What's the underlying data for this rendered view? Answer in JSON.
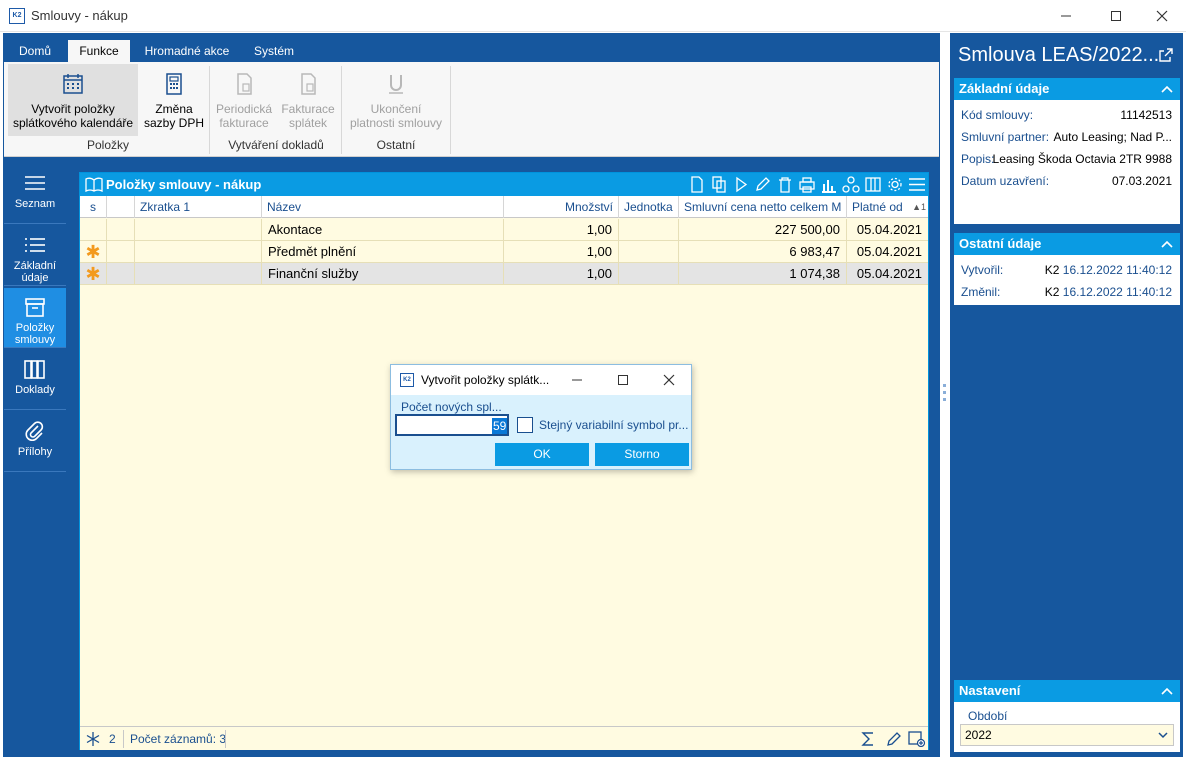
{
  "window": {
    "title": "Smlouvy - nákup",
    "logo": "K2"
  },
  "ribbon": {
    "tabs": [
      {
        "label": "Domů"
      },
      {
        "label": "Funkce"
      },
      {
        "label": "Hromadné akce"
      },
      {
        "label": "Systém"
      }
    ],
    "buttons": {
      "create_items": {
        "line1": "Vytvořit položky",
        "line2": "splátkového kalendáře"
      },
      "vat_change": {
        "line1": "Změna",
        "line2": "sazby DPH"
      },
      "periodic_invoice": {
        "line1": "Periodická",
        "line2": "fakturace"
      },
      "installment_invoice": {
        "line1": "Fakturace",
        "line2": "splátek"
      },
      "end_validity": {
        "line1": "Ukončení",
        "line2": "platnosti smlouvy"
      }
    },
    "groups": {
      "items": "Položky",
      "documents": "Vytváření dokladů",
      "other": "Ostatní"
    }
  },
  "nav": {
    "list": "Seznam",
    "basic_1": "Základní",
    "basic_2": "údaje",
    "items_1": "Položky",
    "items_2": "smlouvy",
    "docs": "Doklady",
    "attachments": "Přílohy"
  },
  "grid": {
    "title": "Položky smlouvy - nákup",
    "columns": {
      "s": "s",
      "abbr": "Zkratka 1",
      "name": "Název",
      "qty": "Množství",
      "unit": "Jednotka",
      "price": "Smluvní cena netto celkem M",
      "valid": "Platné od"
    },
    "sort_marker": "1",
    "rows": [
      {
        "name": "Akontace",
        "qty": "1,00",
        "price": "227 500,00",
        "valid": "05.04.2021"
      },
      {
        "name": "Předmět plnění",
        "qty": "1,00",
        "price": "6 983,47",
        "valid": "05.04.2021"
      },
      {
        "name": "Finanční služby",
        "qty": "1,00",
        "price": "1 074,38",
        "valid": "05.04.2021"
      }
    ],
    "footer": {
      "count_num": "2",
      "records": "Počet záznamů: 3"
    }
  },
  "right": {
    "title": "Smlouva LEAS/2022...",
    "basic": {
      "header": "Základní údaje",
      "contract_code_label": "Kód smlouvy:",
      "contract_code": "11142513",
      "partner_label": "Smluvní partner:",
      "partner": "Auto Leasing; Nad P...",
      "desc_label": "Popis:",
      "desc": "Leasing Škoda Octavia 2TR 9988",
      "date_label": "Datum uzavření:",
      "date": "07.03.2021"
    },
    "other": {
      "header": "Ostatní údaje",
      "created_label": "Vytvořil:",
      "created_user": "K2",
      "created_date": "16.12.2022 11:40:12",
      "changed_label": "Změnil:",
      "changed_user": "K2",
      "changed_date": "16.12.2022 11:40:12"
    },
    "settings": {
      "header": "Nastavení",
      "period_label": "Období",
      "period_value": "2022"
    }
  },
  "dialog": {
    "title": "Vytvořit položky splátk...",
    "count_label": "Počet nových spl...",
    "count_value": "59",
    "same_vs_label": "Stejný variabilní symbol pr...",
    "ok": "OK",
    "cancel": "Storno"
  }
}
